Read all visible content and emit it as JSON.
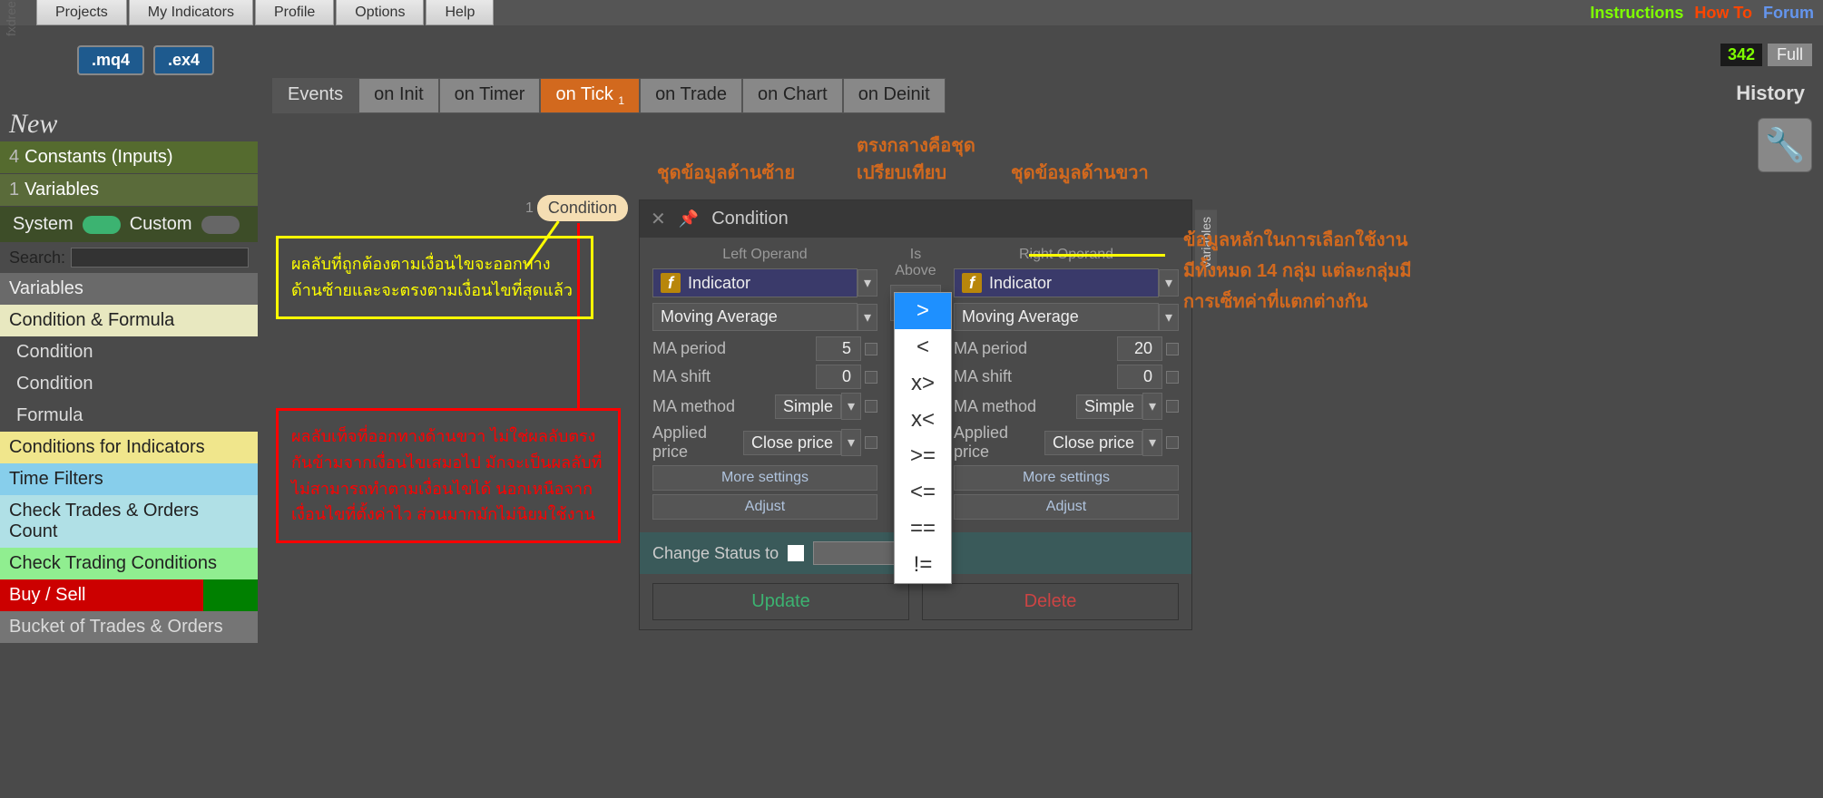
{
  "menu": [
    "Projects",
    "My Indicators",
    "Profile",
    "Options",
    "Help"
  ],
  "links": {
    "instructions": "Instructions",
    "howto": "How To",
    "forum": "Forum"
  },
  "brand": "fxdreema",
  "files": {
    "mq4": ".mq4",
    "ex4": ".ex4"
  },
  "status": {
    "num": "342",
    "full": "Full"
  },
  "tabs": [
    "Events",
    "on Init",
    "on Timer",
    "on Tick",
    "on Trade",
    "on Chart",
    "on Deinit"
  ],
  "active_tab_sub": "1",
  "history": "History",
  "new_label": "New",
  "sidebar": {
    "constants": {
      "count": "4",
      "label": "Constants (Inputs)"
    },
    "variables": {
      "count": "1",
      "label": "Variables"
    },
    "system": "System",
    "custom": "Custom",
    "search": "Search:",
    "var_head": "Variables",
    "cats": {
      "cf": "Condition & Formula",
      "cond1": "Condition",
      "cond2": "Condition",
      "formula": "Formula",
      "cfi": "Conditions for Indicators",
      "tf": "Time Filters",
      "ct": "Check Trades & Orders Count",
      "ctc": "Check Trading Conditions",
      "bs": "Buy / Sell",
      "bot": "Bucket of Trades & Orders"
    }
  },
  "node": {
    "num": "1",
    "label": "Condition"
  },
  "yellow_text": "ผลลับที่ถูกต้องตามเงื่อนไขจะออกทางด้านซ้ายและจะตรงตามเงื่อนไขที่สุดแล้ว",
  "red_text": "ผลลับเท็จที่ออกทางด้านขวา ไม่ใช่ผลลับตรงกันข้ามจากเงื่อนไขเสมอไป มักจะเป็นผลลับที่ไม่สามารถทำตามเงื่อนไขได้ นอกเหนือจากเงื่อนไขที่ตั้งค่าไว ส่วนมากมักไม่นิยมใช้งาน",
  "ann": {
    "left": "ชุดข้อมูลด้านซ้าย",
    "mid1": "ตรงกลางคือชุด",
    "mid2": "เปรียบเทียบ",
    "right": "ชุดข้อมูลด้านขวา",
    "info1": "ข้อมูลหลักในการเลือกใช้งาน",
    "info2": "มีทั้งหมด 14 กลุ่ม แต่ละกลุ่มมี",
    "info3": "การเซ็ทค่าที่แตกต่างกัน"
  },
  "panel": {
    "title": "Condition",
    "left_h": "Left Operand",
    "mid_h": "Is Above",
    "right_h": "Right Operand",
    "indicator": "Indicator",
    "ma": "Moving Average",
    "p_period": "MA period",
    "p_shift": "MA shift",
    "p_method": "MA method",
    "p_price": "Applied price",
    "v_period_l": "5",
    "v_period_r": "20",
    "v_shift": "0",
    "v_method": "Simple",
    "v_price": "Close price",
    "more": "More settings",
    "adjust": "Adjust",
    "change": "Change Status to",
    "update": "Update",
    "delete": "Delete",
    "vartab": "Variables"
  },
  "ops": [
    ">",
    "<",
    "x>",
    "x<",
    ">=",
    "<=",
    "==",
    "!="
  ]
}
